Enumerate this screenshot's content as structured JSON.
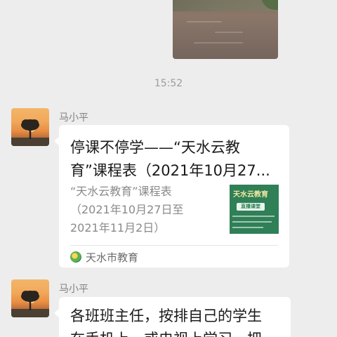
{
  "timestamp": "15:52",
  "messages": [
    {
      "sender": "马小平",
      "type": "link",
      "title_line1": "停课不停学——“天水云教",
      "title_line2": "育”课程表（2021年10月27...",
      "desc_line1": "“天水云教育”课程表",
      "desc_line2": "（2021年10月27日至",
      "desc_line3": "2021年11月2日）",
      "thumbnail_text": "天水云教育",
      "thumbnail_badge": "直播课堂",
      "source": "天水市教育",
      "source_icon": "tianshui-education-logo-icon"
    },
    {
      "sender": "马小平",
      "type": "text",
      "text_line1": "各班班主任，按排自己的学生",
      "text_line2": "在手机上，或电视上学习，把"
    }
  ],
  "colors": {
    "background": "#ededed",
    "bubble": "#ffffff",
    "secondary_text": "#8a8a8a",
    "thumbnail_bg": "#2f7f57"
  }
}
